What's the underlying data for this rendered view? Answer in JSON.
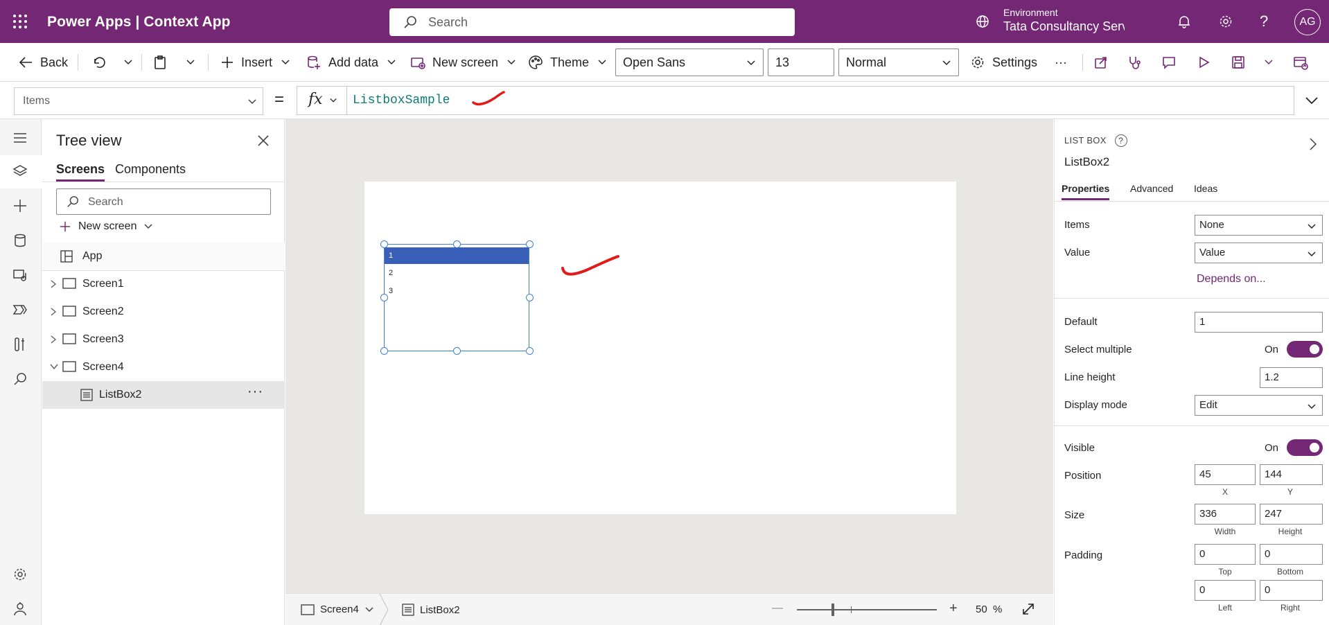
{
  "app": {
    "title": "Power Apps  |  Context App"
  },
  "topbar": {
    "search_placeholder": "Search",
    "environment_label": "Environment",
    "environment_value": "Tata Consultancy Servic...",
    "avatar_initials": "AG"
  },
  "commands": {
    "back": "Back",
    "insert": "Insert",
    "add_data": "Add data",
    "new_screen": "New screen",
    "theme": "Theme",
    "font": "Open Sans",
    "font_size": "13",
    "font_weight": "Normal",
    "settings": "Settings",
    "more": "···"
  },
  "formula_bar": {
    "property": "Items",
    "equals": "=",
    "fx": "fx",
    "formula": "ListboxSample"
  },
  "tree_view": {
    "title": "Tree view",
    "tabs": [
      "Screens",
      "Components"
    ],
    "search_placeholder": "Search",
    "new_screen": "New screen",
    "app": "App",
    "screens": [
      "Screen1",
      "Screen2",
      "Screen3",
      "Screen4"
    ],
    "child": "ListBox2",
    "child_more": "···"
  },
  "canvas": {
    "listbox_items": [
      "1",
      "2",
      "3"
    ],
    "selected_index": 0
  },
  "statusbar": {
    "screen": "Screen4",
    "control": "ListBox2",
    "zoom_minus": "—",
    "zoom_plus": "+",
    "zoom_value": "50",
    "zoom_unit": "%"
  },
  "properties": {
    "kind": "LIST BOX",
    "help": "?",
    "name": "ListBox2",
    "tabs": [
      "Properties",
      "Advanced",
      "Ideas"
    ],
    "items_label": "Items",
    "items_value": "None",
    "value_label": "Value",
    "value_value": "Value",
    "depends_on": "Depends on...",
    "default_label": "Default",
    "default_value": "1",
    "select_multiple_label": "Select multiple",
    "select_multiple_state": "On",
    "line_height_label": "Line height",
    "line_height_value": "1.2",
    "display_mode_label": "Display mode",
    "display_mode_value": "Edit",
    "visible_label": "Visible",
    "visible_state": "On",
    "position_label": "Position",
    "x": "45",
    "y": "144",
    "x_label": "X",
    "y_label": "Y",
    "size_label": "Size",
    "width": "336",
    "height": "247",
    "width_label": "Width",
    "height_label": "Height",
    "padding_label": "Padding",
    "pad_top": "0",
    "pad_bottom": "0",
    "pad_left": "0",
    "pad_right": "0",
    "top_label": "Top",
    "bottom_label": "Bottom",
    "left_label": "Left",
    "right_label": "Right"
  },
  "colors": {
    "brand": "#742774",
    "selection": "#3a5fb8",
    "formula_text": "#0e7b74",
    "annotation": "#e01b1b"
  }
}
